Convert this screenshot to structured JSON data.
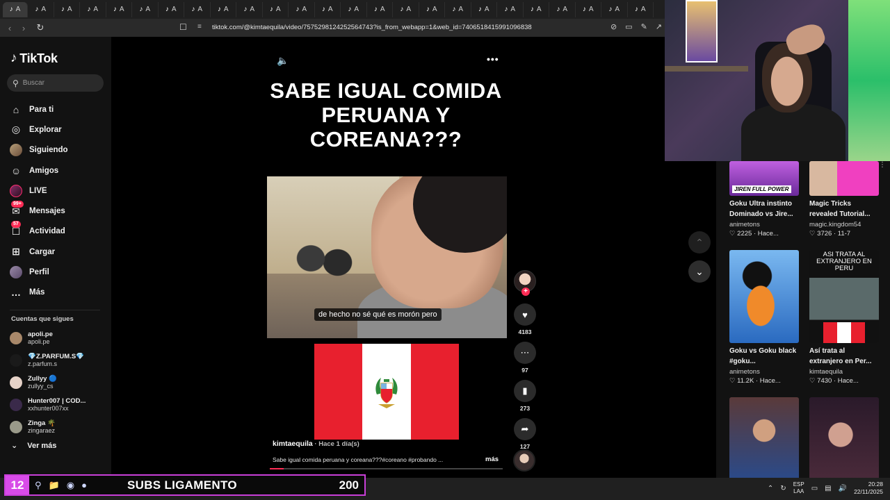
{
  "browser": {
    "tabs": [
      {
        "icon": "tiktok-icon",
        "label": "A"
      },
      {
        "icon": "tiktok-icon",
        "label": "A"
      },
      {
        "icon": "tiktok-icon",
        "label": "A"
      },
      {
        "icon": "tiktok-icon",
        "label": "A"
      },
      {
        "icon": "tiktok-icon",
        "label": "A"
      },
      {
        "icon": "tiktok-icon",
        "label": "A"
      },
      {
        "icon": "tiktok-icon",
        "label": "A"
      },
      {
        "icon": "tiktok-icon",
        "label": "A"
      },
      {
        "icon": "tiktok-icon",
        "label": "A"
      },
      {
        "icon": "tiktok-icon",
        "label": "A"
      },
      {
        "icon": "tiktok-icon",
        "label": "A"
      },
      {
        "icon": "tiktok-icon",
        "label": "A"
      },
      {
        "icon": "tiktok-icon",
        "label": "A"
      },
      {
        "icon": "tiktok-icon",
        "label": "A"
      },
      {
        "icon": "tiktok-icon",
        "label": "A"
      },
      {
        "icon": "tiktok-icon",
        "label": "A"
      },
      {
        "icon": "tiktok-icon",
        "label": "A"
      },
      {
        "icon": "tiktok-icon",
        "label": "A"
      },
      {
        "icon": "tiktok-icon",
        "label": "A"
      },
      {
        "icon": "tiktok-icon",
        "label": "A"
      },
      {
        "icon": "tiktok-icon",
        "label": "A"
      },
      {
        "icon": "tiktok-icon",
        "label": "A"
      },
      {
        "icon": "tiktok-icon",
        "label": "A"
      },
      {
        "icon": "tiktok-icon",
        "label": "A"
      },
      {
        "icon": "tiktok-icon",
        "label": "A"
      }
    ],
    "url": "tiktok.com/@kimtaequila/video/7575298124252564743?is_from_webapp=1&web_id=7406518415991096838"
  },
  "sidebar": {
    "brand": "TikTok",
    "search_placeholder": "Buscar",
    "nav": [
      {
        "label": "Para ti",
        "icon": "home-icon"
      },
      {
        "label": "Explorar",
        "icon": "compass-icon"
      },
      {
        "label": "Siguiendo",
        "icon": "following-avatar-icon"
      },
      {
        "label": "Amigos",
        "icon": "friends-icon"
      },
      {
        "label": "LIVE",
        "icon": "live-avatar-icon"
      },
      {
        "label": "Mensajes",
        "icon": "messages-icon",
        "badge": "99+"
      },
      {
        "label": "Actividad",
        "icon": "activity-icon",
        "badge": "57"
      },
      {
        "label": "Cargar",
        "icon": "upload-icon"
      },
      {
        "label": "Perfil",
        "icon": "profile-avatar-icon"
      },
      {
        "label": "Más",
        "icon": "more-icon"
      }
    ],
    "following_heading": "Cuentas que sigues",
    "following": [
      {
        "name": "apoli.pe",
        "handle": "apoli.pe",
        "color": "#a8886a"
      },
      {
        "name": "💎Z.PARFUM.S💎",
        "handle": "z.parfum.s",
        "color": "#1a1a1a"
      },
      {
        "name": "Zullyy 🔵",
        "handle": "zullyy_cs",
        "color": "#e6d2c8"
      },
      {
        "name": "Hunter007 | COD...",
        "handle": "xxhunter007xx",
        "color": "#3a2a4a"
      },
      {
        "name": "Zinga 🌴",
        "handle": "zingaraez",
        "color": "#9a9a8a"
      }
    ],
    "see_more": "Ver más"
  },
  "video": {
    "overlay_title": "SABE IGUAL COMIDA PERUANA Y COREANA???",
    "subtitle": "de hecho no sé qué es morón pero",
    "author": "kimtaequila",
    "time": " · Hace 1 día(s)",
    "caption": "Sabe igual comida peruana y coreana???#coreano #probando ...",
    "caption_more": "más",
    "progress": 0.06,
    "likes": "4183",
    "comments": "97",
    "saves": "273",
    "shares": "127"
  },
  "related": [
    {
      "title": "Goku Ultra instinto Dominado vs Jire...",
      "author": "animetons",
      "likes": "2225",
      "ago": "Hace...",
      "thumb_text": "JIREN FULL POWER"
    },
    {
      "title": "Magic Tricks revealed Tutorial...",
      "author": "magic.kingdom54",
      "likes": "3726",
      "ago": "11-7",
      "thumb_text": ""
    },
    {
      "title": "Goku vs Goku black #goku...",
      "author": "animetons",
      "likes": "11.2K",
      "ago": "Hace...",
      "thumb_text": ""
    },
    {
      "title": "Así trata al extranjero en Per...",
      "author": "kimtaequila",
      "likes": "7430",
      "ago": "Hace...",
      "thumb_text": "ASI TRATA AL EXTRANJERO EN PERU"
    }
  ],
  "overlay_bar": {
    "number": "12",
    "label": "SUBS LIGAMENTO",
    "count": "200"
  },
  "tray": {
    "lang1": "ESP",
    "lang2": "LAA",
    "time": "20:28",
    "date": "22/11/2025"
  },
  "colors": {
    "accent": "#fe2c55",
    "flag_red": "#e8202e",
    "overlay_border": "#c93fd8"
  }
}
